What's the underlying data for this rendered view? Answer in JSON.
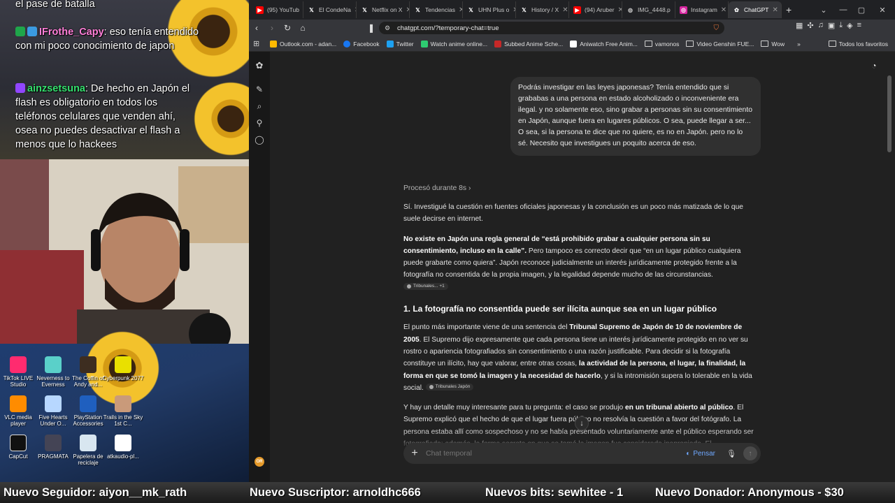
{
  "stream": {
    "chat": [
      {
        "user": "",
        "text": "el pase de batalla"
      },
      {
        "user": "IFrothe_Capy",
        "text": ": eso tenía entendido con mi poco conocimiento de japon"
      },
      {
        "user": "ainzsetsuna",
        "text": ": De hecho en Japón el flash es obligatorio en todos los teléfonos celulares que venden ahí, osea no puedes desactivar el flash a menos que lo hackees"
      }
    ],
    "desktop_icons": [
      "TikTok LIVE Studio",
      "Neverness to Everness",
      "The Coffin of Andy and...",
      "Cyberpunk 2077",
      "VLC media player",
      "Five Hearts Under O...",
      "PlayStation Accessories",
      "Trails in the Sky 1st C...",
      "CapCut",
      "PRAGMATA",
      "Papelera de reciclaje",
      "atkaudio-pl..."
    ],
    "ticker": [
      "Nuevo Seguidor: aiyon__mk_rath",
      "Nuevo Suscriptor: arnoldhc666",
      "Nuevos bits: sewhitee - 1",
      "Nuevo Donador: Anonymous - $30"
    ]
  },
  "browser": {
    "tabs": [
      {
        "label": "(95) YouTub",
        "icon": "youtube-icon",
        "color": "#ff0000"
      },
      {
        "label": "El CondeNa",
        "icon": "x-icon",
        "color": "#000000"
      },
      {
        "label": "Netflix on X",
        "icon": "x-icon",
        "color": "#000000"
      },
      {
        "label": "Tendencias",
        "icon": "x-icon",
        "color": "#000000"
      },
      {
        "label": "UHN Plus o",
        "icon": "x-icon",
        "color": "#000000"
      },
      {
        "label": "History / X",
        "icon": "x-icon",
        "color": "#000000"
      },
      {
        "label": "(94) Aruber",
        "icon": "youtube-icon",
        "color": "#ff0000"
      },
      {
        "label": "IMG_4448.p",
        "icon": "globe-icon",
        "color": "#5f6368"
      },
      {
        "label": "Instagram",
        "icon": "instagram-icon",
        "color": "#d6249f"
      },
      {
        "label": "ChatGPT",
        "icon": "chatgpt-icon",
        "color": "#ffffff"
      }
    ],
    "url": "chatgpt.com/?temporary-chat=true",
    "bookmarks": [
      {
        "label": "Outlook.com - adan...",
        "color": "#ffb900"
      },
      {
        "label": "Facebook",
        "color": "#1877f2"
      },
      {
        "label": "Twitter",
        "color": "#1da1f2"
      },
      {
        "label": "Watch anime online...",
        "color": "#2ecc71"
      },
      {
        "label": "Subbed Anime Sche...",
        "color": "#c62828"
      },
      {
        "label": "Aniwatch Free Anim...",
        "color": "#ffffff"
      },
      {
        "label": "vamonos",
        "color": "folder"
      },
      {
        "label": "Video Genshin FUE...",
        "color": "folder"
      },
      {
        "label": "Wow",
        "color": "folder"
      }
    ],
    "bookmarks_more": "»",
    "all_bookmarks": "Todos los favoritos"
  },
  "chat": {
    "user_message": "Podrás investigar en las leyes japonesas? Tenía entendido que si grababas a una persona en estado alcoholizado o inconveniente era ilegal. y no solamente eso, sino grabar a personas sin su consentimiento en Japón, aunque fuera en lugares públicos. O sea, puede llegar a ser... O sea, si la persona te dice que no quiere, es no en Japón. pero no lo sé. Necesito que investigues un poquito acerca de eso.",
    "thought": "Procesó durante 8s",
    "p1": "Sí. Investigué la cuestión en fuentes oficiales japonesas y la conclusión es un poco más matizada de lo que suele decirse en internet.",
    "p2_bold": "No existe en Japón una regla general de “está prohibido grabar a cualquier persona sin su consentimiento, incluso en la calle”.",
    "p2_rest": " Pero tampoco es correcto decir que “en un lugar público cualquiera puede grabarte como quiera”. Japón reconoce judicialmente un interés jurídicamente protegido frente a la fotografía no consentida de la propia imagen, y la legalidad depende mucho de las circunstancias.",
    "cite1": "Tribunales... +1",
    "h1": "1. La fotografía no consentida puede ser ilícita aunque sea en un lugar público",
    "p3_a": "El punto más importante viene de una sentencia del ",
    "p3_b": "Tribunal Supremo de Japón de 10 de noviembre de 2005",
    "p3_c": ". El Supremo dijo expresamente que cada persona tiene un interés jurídicamente protegido en no ver su rostro o apariencia fotografiados sin consentimiento o una razón justificable. Para decidir si la fotografía constituye un ilícito, hay que valorar, entre otras cosas, ",
    "p3_d": "la actividad de la persona, el lugar, la finalidad, la forma en que se tomó la imagen y la necesidad de hacerlo",
    "p3_e": ", y si la intromisión supera lo tolerable en la vida social.",
    "cite2": "Tribunales Japón",
    "p4_a": "Y hay un detalle muy interesante para tu pregunta: el caso se produjo ",
    "p4_b": "en un tribunal abierto al público",
    "p4_c": ". El Supremo explicó que el hecho de que el lugar fuera público no resolvía la cuestión a favor del fotógrafo. La persona estaba allí como sospechoso y no se había presentado voluntariamente ante el público esperando ser fotografiada; además, la forma secreta en que se tomó la imagen fue considerada inapropiada. El",
    "composer_placeholder": "Chat temporal",
    "think_label": "Pensar",
    "avatar_initials": "OR"
  }
}
